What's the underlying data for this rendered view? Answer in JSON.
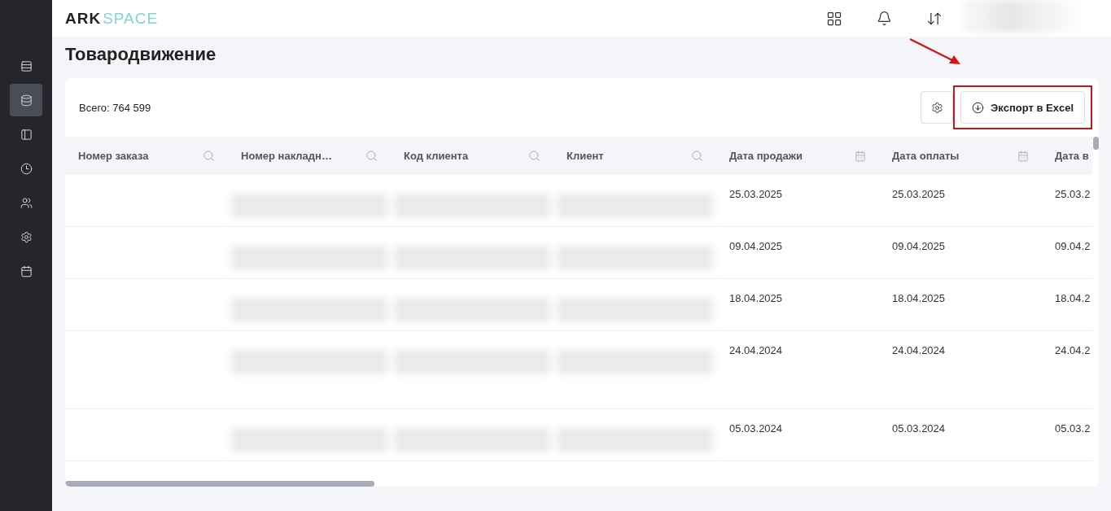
{
  "logo": {
    "part_1": "ARK",
    "part_2": "SPACE"
  },
  "sidebar": {
    "items": [
      {
        "selected": false
      },
      {
        "selected": true
      },
      {
        "selected": false
      },
      {
        "selected": false
      },
      {
        "selected": false
      },
      {
        "selected": false
      },
      {
        "selected": false
      }
    ]
  },
  "page_title": "Товародвижение",
  "total": "Всего: 764 599",
  "export_button": {
    "label": "Экспорт в Excel",
    "highlighted": true
  },
  "table": {
    "columns": [
      {
        "label": "Номер заказа",
        "kind": "text"
      },
      {
        "label": "Номер накладн…",
        "kind": "text"
      },
      {
        "label": "Код клиента",
        "kind": "text"
      },
      {
        "label": "Клиент",
        "kind": "text"
      },
      {
        "label": "Дата продажи",
        "kind": "date"
      },
      {
        "label": "Дата оплаты",
        "kind": "date"
      },
      {
        "label": "Дата в",
        "kind": "cut"
      }
    ],
    "rows": [
      {
        "tall": false,
        "cells": [
          {
            "kind": "empty"
          },
          {
            "kind": "redacted"
          },
          {
            "kind": "redacted"
          },
          {
            "kind": "redacted"
          },
          {
            "kind": "text",
            "text": "25.03.2025"
          },
          {
            "kind": "text",
            "text": "25.03.2025"
          },
          {
            "kind": "text",
            "text": "25.03.2"
          }
        ]
      },
      {
        "tall": false,
        "cells": [
          {
            "kind": "empty"
          },
          {
            "kind": "redacted"
          },
          {
            "kind": "redacted"
          },
          {
            "kind": "redacted"
          },
          {
            "kind": "text",
            "text": "09.04.2025"
          },
          {
            "kind": "text",
            "text": "09.04.2025"
          },
          {
            "kind": "text",
            "text": "09.04.2"
          }
        ]
      },
      {
        "tall": false,
        "cells": [
          {
            "kind": "empty"
          },
          {
            "kind": "redacted"
          },
          {
            "kind": "redacted"
          },
          {
            "kind": "redacted"
          },
          {
            "kind": "text",
            "text": "18.04.2025"
          },
          {
            "kind": "text",
            "text": "18.04.2025"
          },
          {
            "kind": "text",
            "text": "18.04.2"
          }
        ]
      },
      {
        "tall": true,
        "cells": [
          {
            "kind": "empty"
          },
          {
            "kind": "redacted"
          },
          {
            "kind": "redacted"
          },
          {
            "kind": "redacted"
          },
          {
            "kind": "text",
            "text": "24.04.2024"
          },
          {
            "kind": "text",
            "text": "24.04.2024"
          },
          {
            "kind": "text",
            "text": "24.04.2"
          }
        ]
      },
      {
        "tall": false,
        "cells": [
          {
            "kind": "empty"
          },
          {
            "kind": "redacted"
          },
          {
            "kind": "redacted"
          },
          {
            "kind": "redacted"
          },
          {
            "kind": "text",
            "text": "05.03.2024"
          },
          {
            "kind": "text",
            "text": "05.03.2024"
          },
          {
            "kind": "text",
            "text": "05.03.2"
          }
        ]
      }
    ]
  }
}
